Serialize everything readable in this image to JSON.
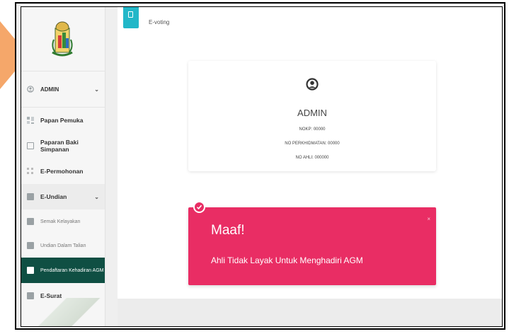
{
  "breadcrumb": {
    "text": "E-voting"
  },
  "sidebar": {
    "user": {
      "label": "ADMIN"
    },
    "items": [
      {
        "label": "Papan Pemuka"
      },
      {
        "label": "Paparan Baki Simpanan"
      },
      {
        "label": "E-Permohonan"
      },
      {
        "label": "E-Undian"
      },
      {
        "label": "Semak Kelayakan"
      },
      {
        "label": "Undian Dalam Talian"
      },
      {
        "label": "Pendaftaran Kehadiran AGM"
      },
      {
        "label": "E-Surat"
      }
    ]
  },
  "profile": {
    "name": "ADMIN",
    "nokp": "NOKP: 00000",
    "no_perkhidmatan": "NO PERKHIDMATAN: 00000",
    "no_ahli": "NO AHLI: 000000"
  },
  "alert": {
    "title": "Maaf!",
    "message": "Ahli Tidak Layak Untuk Menghadiri AGM",
    "close": "×"
  },
  "colors": {
    "alert": "#e92d64",
    "breadcrumb_accent": "#22b7c8",
    "active_menu": "#0f4f43",
    "side_tab": "#f5a76a"
  }
}
